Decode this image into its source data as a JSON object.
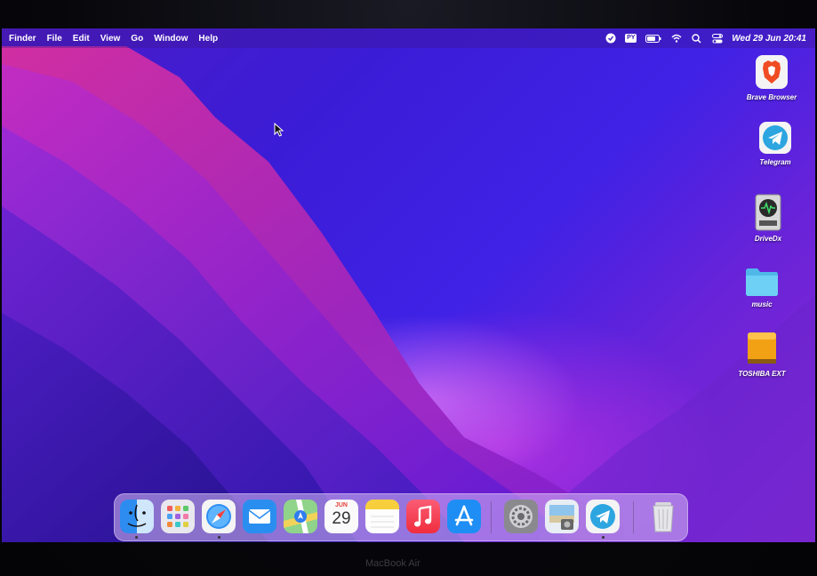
{
  "menubar": {
    "app_name": "Finder",
    "menus": [
      "File",
      "Edit",
      "View",
      "Go",
      "Window",
      "Help"
    ],
    "clock": "Wed 29 Jun  20:41",
    "status_icons": [
      "vpn-icon",
      "py-keyboard-icon",
      "battery-icon",
      "wifi-icon",
      "spotlight-search-icon",
      "control-center-icon"
    ],
    "py_badge": "PY"
  },
  "desktop_icons": [
    {
      "label": "Brave Browser",
      "icon": "brave-browser-icon"
    },
    {
      "label": "Telegram",
      "icon": "telegram-icon"
    },
    {
      "label": "DriveDx",
      "icon": "drivedx-icon"
    },
    {
      "label": "music",
      "icon": "folder-icon"
    },
    {
      "label": "TOSHIBA EXT",
      "icon": "external-drive-icon"
    }
  ],
  "dock": {
    "apps": [
      "Finder",
      "Launchpad",
      "Safari",
      "Mail",
      "Maps",
      "Calendar",
      "Notes",
      "Music",
      "App Store",
      "System Preferences",
      "Preview",
      "Telegram",
      "Trash"
    ],
    "calendar_month": "JUN",
    "calendar_day": "29"
  },
  "device_label": "MacBook Air",
  "colors": {
    "wallpaper_primary": "#3f22e6",
    "wallpaper_accent": "#e03ce0",
    "folder_blue": "#5ec8f2"
  }
}
